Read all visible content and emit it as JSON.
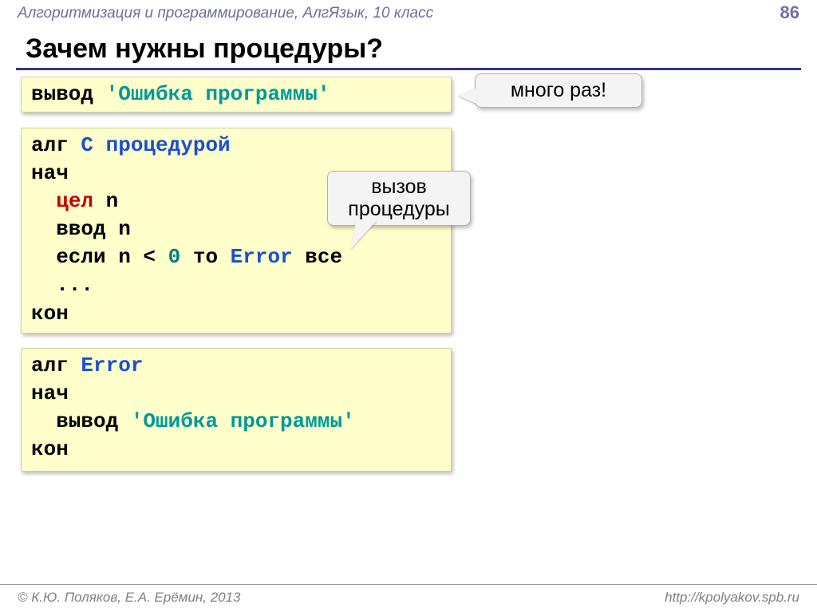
{
  "header": {
    "course": "Алгоритмизация и программирование, АлгЯзык, 10 класс",
    "page": "86"
  },
  "title": "Зачем нужны процедуры?",
  "callouts": {
    "many": "много раз!",
    "call_l1": "вызов",
    "call_l2": "процедуры"
  },
  "box1": {
    "kw_out": "вывод ",
    "str": "'Ошибка программы'"
  },
  "box2": {
    "l1_kw": "алг ",
    "l1_name": "С процедурой",
    "l2": "нач",
    "l3_pad": "  ",
    "l3_type": "цел",
    "l3_rest": " n",
    "l4": "  ввод n",
    "l5_a": "  если n < ",
    "l5_num": "0",
    "l5_b": " то ",
    "l5_name": "Error",
    "l5_c": " все",
    "l6": "  ...",
    "l7": "кон"
  },
  "box3": {
    "l1_kw": "алг ",
    "l1_name": "Error",
    "l2": "нач",
    "l3_a": "  вывод ",
    "l3_str": "'Ошибка программы'",
    "l4": "кон"
  },
  "footer": {
    "left": "© К.Ю. Поляков, Е.А. Ерёмин, 2013",
    "right": "http://kpolyakov.spb.ru"
  }
}
